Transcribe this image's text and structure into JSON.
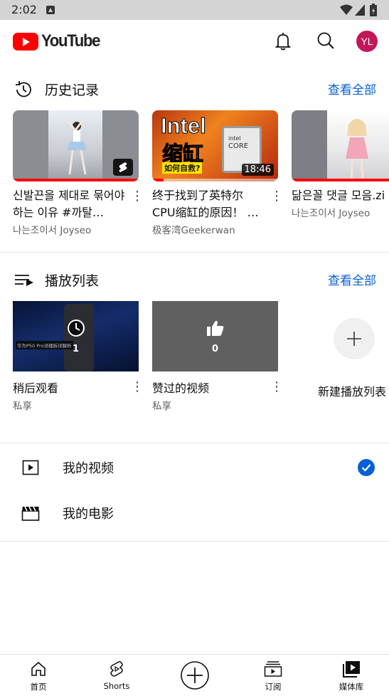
{
  "status_bar": {
    "time": "2:02"
  },
  "app": {
    "logo_text": "YouTube",
    "avatar_initials": "YL",
    "avatar_color": "#c2185b",
    "accent_color": "#065fd4",
    "brand_red": "#ff0000"
  },
  "history": {
    "title": "历史记录",
    "view_all": "查看全部",
    "videos": [
      {
        "title": "신발끈을 제대로 묶어야 하는 이유 #까탈…",
        "channel": "나는조이서 Joyseo",
        "type": "short",
        "progress_pct": 100
      },
      {
        "title": "终于找到了英特尔CPU缩缸的原因！ …",
        "channel": "极客湾Geekerwan",
        "duration": "18:46",
        "thumb_text": [
          "Intel",
          "缩缸",
          "如何自救?"
        ],
        "chip_text": [
          "intel",
          "CORE"
        ],
        "progress_pct": 9
      },
      {
        "title": "닮은꼴 댓글 모음.zi",
        "channel": "나는조이서 Joyseo",
        "progress_pct": 100
      }
    ]
  },
  "playlists": {
    "title": "播放列表",
    "view_all": "查看全部",
    "items": [
      {
        "title": "稍后观看",
        "privacy": "私享",
        "count": "1",
        "thumb_caption": "华为P50 Pro详细拆详解析"
      },
      {
        "title": "赞过的视频",
        "privacy": "私享",
        "count": "0"
      }
    ],
    "new_playlist_label": "新建播放列表"
  },
  "library_items": [
    {
      "label": "我的视频",
      "icon": "play-square-icon",
      "checked": true
    },
    {
      "label": "我的电影",
      "icon": "clapperboard-icon",
      "checked": false
    }
  ],
  "bottom_nav": [
    {
      "label": "首页",
      "icon": "home-icon"
    },
    {
      "label": "Shorts",
      "icon": "shorts-icon"
    },
    {
      "label": "",
      "icon": "create-icon"
    },
    {
      "label": "订阅",
      "icon": "subscriptions-icon"
    },
    {
      "label": "媒体库",
      "icon": "library-icon",
      "active": true
    }
  ]
}
